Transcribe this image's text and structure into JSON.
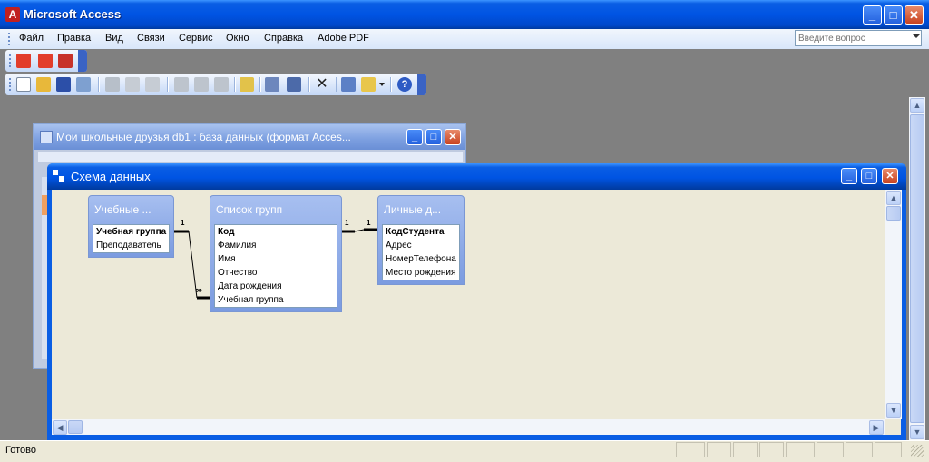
{
  "app": {
    "title": "Microsoft Access"
  },
  "menu": [
    "Файл",
    "Правка",
    "Вид",
    "Связи",
    "Сервис",
    "Окно",
    "Справка",
    "Adobe PDF"
  ],
  "ask": {
    "placeholder": "Введите вопрос"
  },
  "db_window": {
    "title": "Мои школьные друзья.db1 : база данных (формат Acces..."
  },
  "schema_window": {
    "title": "Схема данных"
  },
  "tables": [
    {
      "title": "Учебные ...",
      "fields": [
        {
          "name": "Учебная группа",
          "key": true
        },
        {
          "name": "Преподаватель",
          "key": false
        }
      ]
    },
    {
      "title": "Список групп",
      "fields": [
        {
          "name": "Код",
          "key": true
        },
        {
          "name": "Фамилия",
          "key": false
        },
        {
          "name": "Имя",
          "key": false
        },
        {
          "name": "Отчество",
          "key": false
        },
        {
          "name": "Дата рождения",
          "key": false
        },
        {
          "name": "Учебная группа",
          "key": false
        }
      ]
    },
    {
      "title": "Личные д...",
      "fields": [
        {
          "name": "КодСтудента",
          "key": true
        },
        {
          "name": "Адрес",
          "key": false
        },
        {
          "name": "НомерТелефона",
          "key": false
        },
        {
          "name": "Место рождения",
          "key": false
        }
      ]
    }
  ],
  "relations": [
    {
      "from_label": "1",
      "to_label": "∞"
    },
    {
      "from_label": "1",
      "to_label": "1"
    }
  ],
  "status": {
    "text": "Готово"
  },
  "colors": {
    "title_bar": "#0054e3",
    "canvas": "#ece9d8",
    "table_header": "#8fa9e8"
  }
}
